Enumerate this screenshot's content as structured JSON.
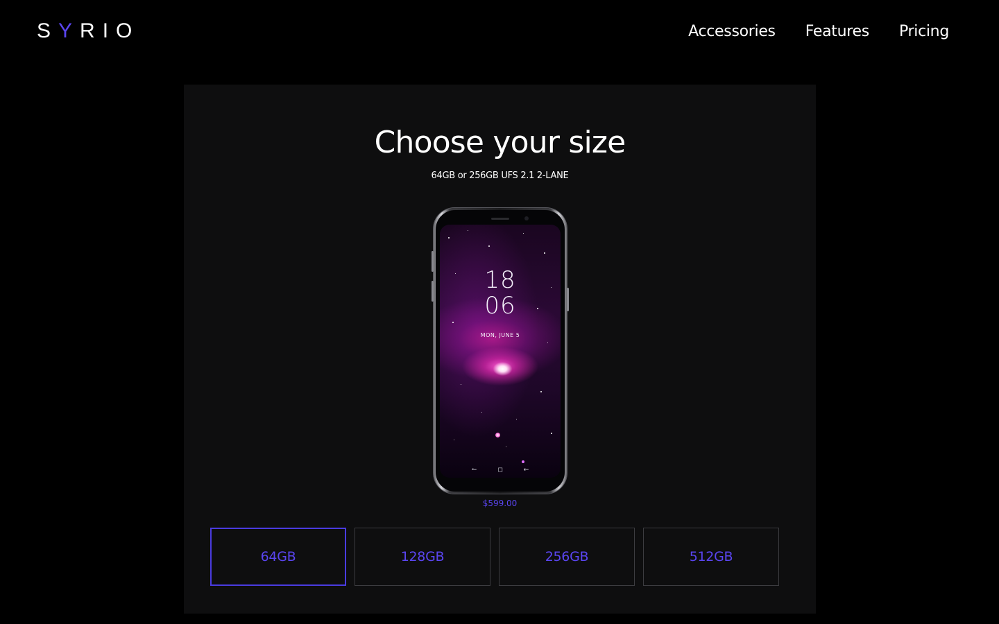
{
  "header": {
    "logo": {
      "letters": [
        "S",
        "Y",
        "R",
        "I",
        "O"
      ],
      "accent_index": 1,
      "accent_color": "#5a45f0"
    },
    "nav": [
      {
        "label": "Accessories"
      },
      {
        "label": "Features"
      },
      {
        "label": "Pricing"
      }
    ]
  },
  "main": {
    "title": "Choose your size",
    "subtitle": "64GB or 256GB UFS 2.1 2-LANE",
    "phone": {
      "clock_hours": "18",
      "clock_minutes": "06",
      "date": "MON, JUNE 5",
      "nav_icons": [
        "recent-apps-icon",
        "home-icon",
        "back-icon"
      ]
    },
    "price": "$599.00",
    "sizes": [
      {
        "label": "64GB",
        "selected": true
      },
      {
        "label": "128GB",
        "selected": false
      },
      {
        "label": "256GB",
        "selected": false
      },
      {
        "label": "512GB",
        "selected": false
      }
    ]
  },
  "colors": {
    "background": "#000000",
    "panel": "#0e0e0f",
    "accent": "#5a45f0",
    "button_border": "#3c3c40"
  }
}
